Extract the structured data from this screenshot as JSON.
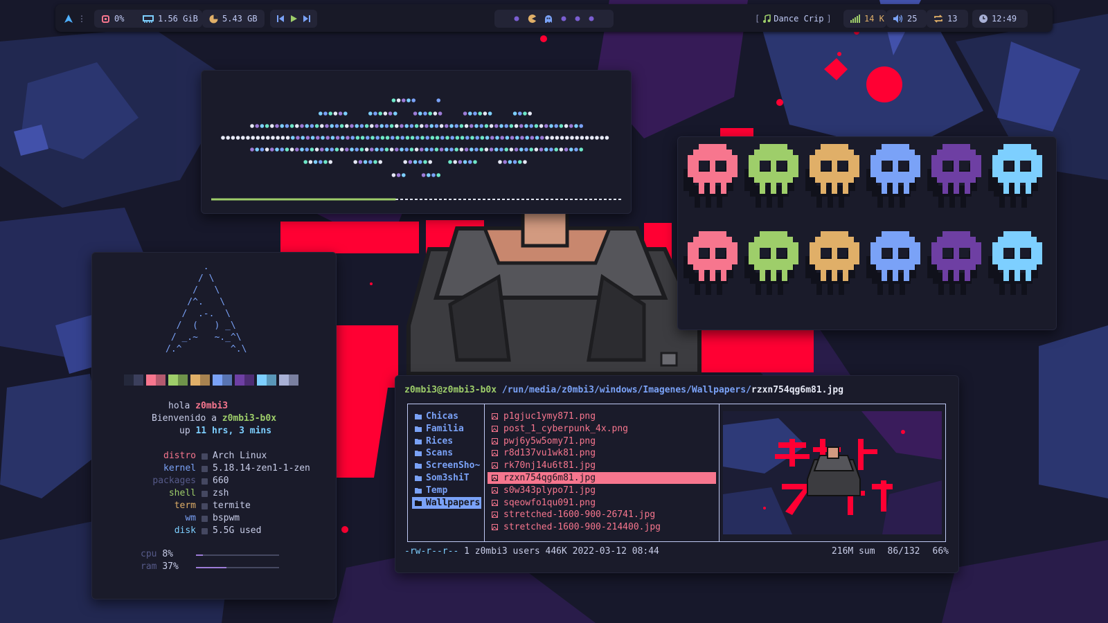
{
  "colors": {
    "bar_bg": "#181927",
    "module_bg": "#232436",
    "window_bg": "#1a1b2a",
    "blue": "#7aa2f7",
    "green": "#9ece6a",
    "red": "#f7768e",
    "yellow": "#e0af68",
    "purple": "#9d7cd8",
    "cyan": "#7dcfff",
    "accent_red": "#ff0033"
  },
  "topbar": {
    "launcher_icon": "arch-logo-icon",
    "menu_dots": "⋮",
    "cpu": "0%",
    "memory": "1.56 GiB",
    "disk": "5.43 GB",
    "player_icons": [
      "previous-icon",
      "play-icon",
      "next-icon"
    ],
    "workspaces_icons": [
      "dot",
      "pacman",
      "ghost",
      "dot",
      "dot",
      "dot"
    ],
    "song_open": "[",
    "song": "Dance Crip",
    "song_close": "]",
    "network": "14 K",
    "volume": "25",
    "updates": "13",
    "clock": "12:49"
  },
  "fetch": {
    "ascii": [
      "       .",
      "      / \\",
      "     /   \\",
      "    /^.   \\",
      "   /  .-.  \\",
      "  /  (   ) _\\",
      " / _.~   ~._^\\",
      "/.^         ^.\\"
    ],
    "greeting_prefix": "hola ",
    "user": "z0mbi3",
    "welcome_prefix": "Bienvenido a ",
    "host": "z0mbi3-b0x",
    "uptime_prefix": "up ",
    "uptime": "11 hrs, 3 mins",
    "info": [
      {
        "key": "distro",
        "value": "Arch Linux",
        "color": "#f7768e"
      },
      {
        "key": "kernel",
        "value": "5.18.14-zen1-1-zen",
        "color": "#7aa2f7"
      },
      {
        "key": "packages",
        "value": "660",
        "color": "#565a89"
      },
      {
        "key": "shell",
        "value": "zsh",
        "color": "#9ece6a"
      },
      {
        "key": "term",
        "value": "termite",
        "color": "#e0af68"
      },
      {
        "key": "wm",
        "value": "bspwm",
        "color": "#7aa2f7"
      },
      {
        "key": "disk",
        "value": "5.5G used",
        "color": "#7dcfff"
      }
    ],
    "cpu_label": "cpu",
    "cpu_value": "8%",
    "cpu_fraction": 0.08,
    "ram_label": "ram",
    "ram_value": "37%",
    "ram_fraction": 0.37
  },
  "visualizer": {
    "progress_fraction": 0.45
  },
  "ranger": {
    "prompt_user": "z0mbi3@z0mbi3-b0x",
    "path": "/run/media/z0mbi3/windows/Imagenes/Wallpapers/",
    "current_file": "rzxn754qg6m81.jpg",
    "folders": [
      "Chicas",
      "Familia",
      "Rices",
      "Scans",
      "ScreenSho~",
      "Som3shiT",
      "Temp",
      "Wallpapers"
    ],
    "selected_folder": 7,
    "files": [
      "p1gjuc1ymy871.png",
      "post_1_cyberpunk_4x.png",
      "pwj6y5w5omy71.png",
      "r8d137vu1wk81.png",
      "rk70nj14u6t81.jpg",
      "rzxn754qg6m81.jpg",
      "s0w343plypo71.jpg",
      "sqeowfo1qu091.png",
      "stretched-1600-900-26741.jpg",
      "stretched-1600-900-214400.jpg"
    ],
    "selected_file": 5,
    "status_perms": "-rw-r--r--",
    "status_info": "1 z0mbi3 users 446K 2022-03-12 08:44",
    "status_sum": "216M sum",
    "status_count": "86/132",
    "status_percent": "66%"
  },
  "skull_colors": [
    "#f7768e",
    "#9ece6a",
    "#e0af68",
    "#7aa2f7",
    "#6e3fa3",
    "#7dcfff"
  ]
}
